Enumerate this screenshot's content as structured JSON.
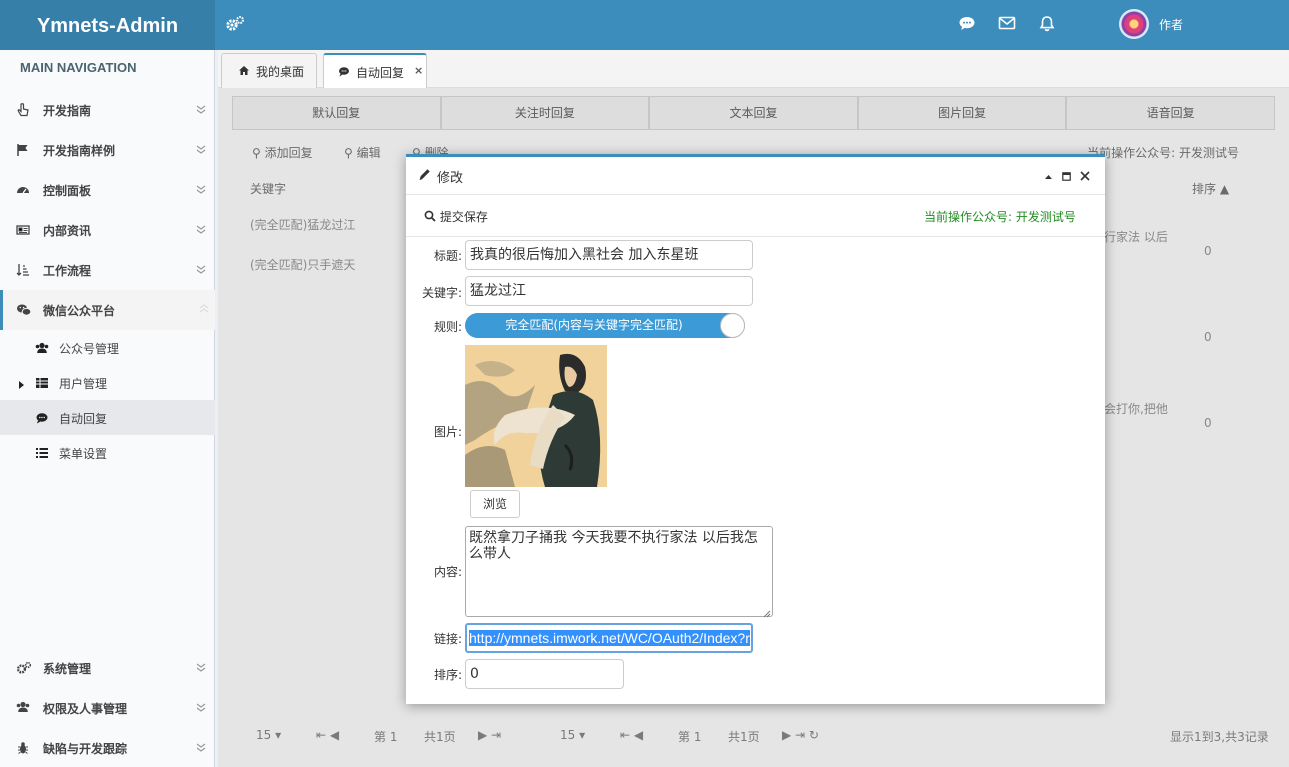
{
  "header": {
    "logo": "Ymnets-Admin",
    "user_name": "作者"
  },
  "sidebar": {
    "heading": "MAIN NAVIGATION",
    "items": [
      {
        "label": "开发指南",
        "icon": "pointer-hand-icon"
      },
      {
        "label": "开发指南样例",
        "icon": "flag-icon"
      },
      {
        "label": "控制面板",
        "icon": "dashboard-icon"
      },
      {
        "label": "内部资讯",
        "icon": "newspaper-icon"
      },
      {
        "label": "工作流程",
        "icon": "sort-icon"
      },
      {
        "label": "微信公众平台",
        "icon": "wechat-icon"
      }
    ],
    "subitems": [
      {
        "label": "公众号管理",
        "icon": "users-icon"
      },
      {
        "label": "用户管理",
        "icon": "table-icon"
      },
      {
        "label": "自动回复",
        "icon": "comment-icon"
      },
      {
        "label": "菜单设置",
        "icon": "list-icon"
      }
    ],
    "bottom_items": [
      {
        "label": "系统管理",
        "icon": "cogs-icon"
      },
      {
        "label": "权限及人事管理",
        "icon": "users-icon"
      },
      {
        "label": "缺陷与开发跟踪",
        "icon": "bug-icon"
      }
    ]
  },
  "tabs": [
    {
      "label": "我的桌面",
      "icon": "home-icon"
    },
    {
      "label": "自动回复",
      "icon": "comment-icon",
      "close": "×"
    }
  ],
  "background": {
    "subtabs": [
      "默认回复",
      "关注时回复",
      "文本回复",
      "图片回复",
      "语音回复"
    ],
    "toolbar": {
      "add": "添加回复",
      "edit": "编辑",
      "delete": "删除",
      "current": "当前操作公众号: 开发测试号"
    },
    "grid": {
      "col_keyword": "关键字",
      "col_sort": "排序",
      "rows": [
        "(完全匹配)猛龙过江",
        "(完全匹配)只手遮天"
      ],
      "sort_values": [
        "0",
        "0",
        "0"
      ],
      "fragments": [
        "行家法 以后",
        "会打你,把他"
      ]
    },
    "pager": {
      "page_size": "15",
      "page_prefix": "第",
      "page": "1",
      "total_pages": "共1页",
      "summary": "显示1到3,共3记录"
    }
  },
  "dialog": {
    "title": "修改",
    "save": "提交保存",
    "current_account": "当前操作公众号: 开发测试号",
    "fields": {
      "title_label": "标题:",
      "title_value": "我真的很后悔加入黑社会 加入东星班",
      "keyword_label": "关键字:",
      "keyword_value": "猛龙过江",
      "rule_label": "规则:",
      "rule_value": "完全匹配(内容与关键字完全匹配)",
      "image_label": "图片:",
      "browse": "浏览",
      "content_label": "内容:",
      "content_value": " 既然拿刀子捅我  今天我要不执行家法  以后我怎么带人",
      "link_label": "链接:",
      "link_value": "http://ymnets.imwork.net/WC/OAuth2/Index?r",
      "sort_label": "排序:",
      "sort_value": "0"
    }
  },
  "colors": {
    "brand": "#3c8dbc",
    "logo_bg": "#367fa9",
    "current_account": "#228b22",
    "toggle": "#3c9ad6"
  }
}
